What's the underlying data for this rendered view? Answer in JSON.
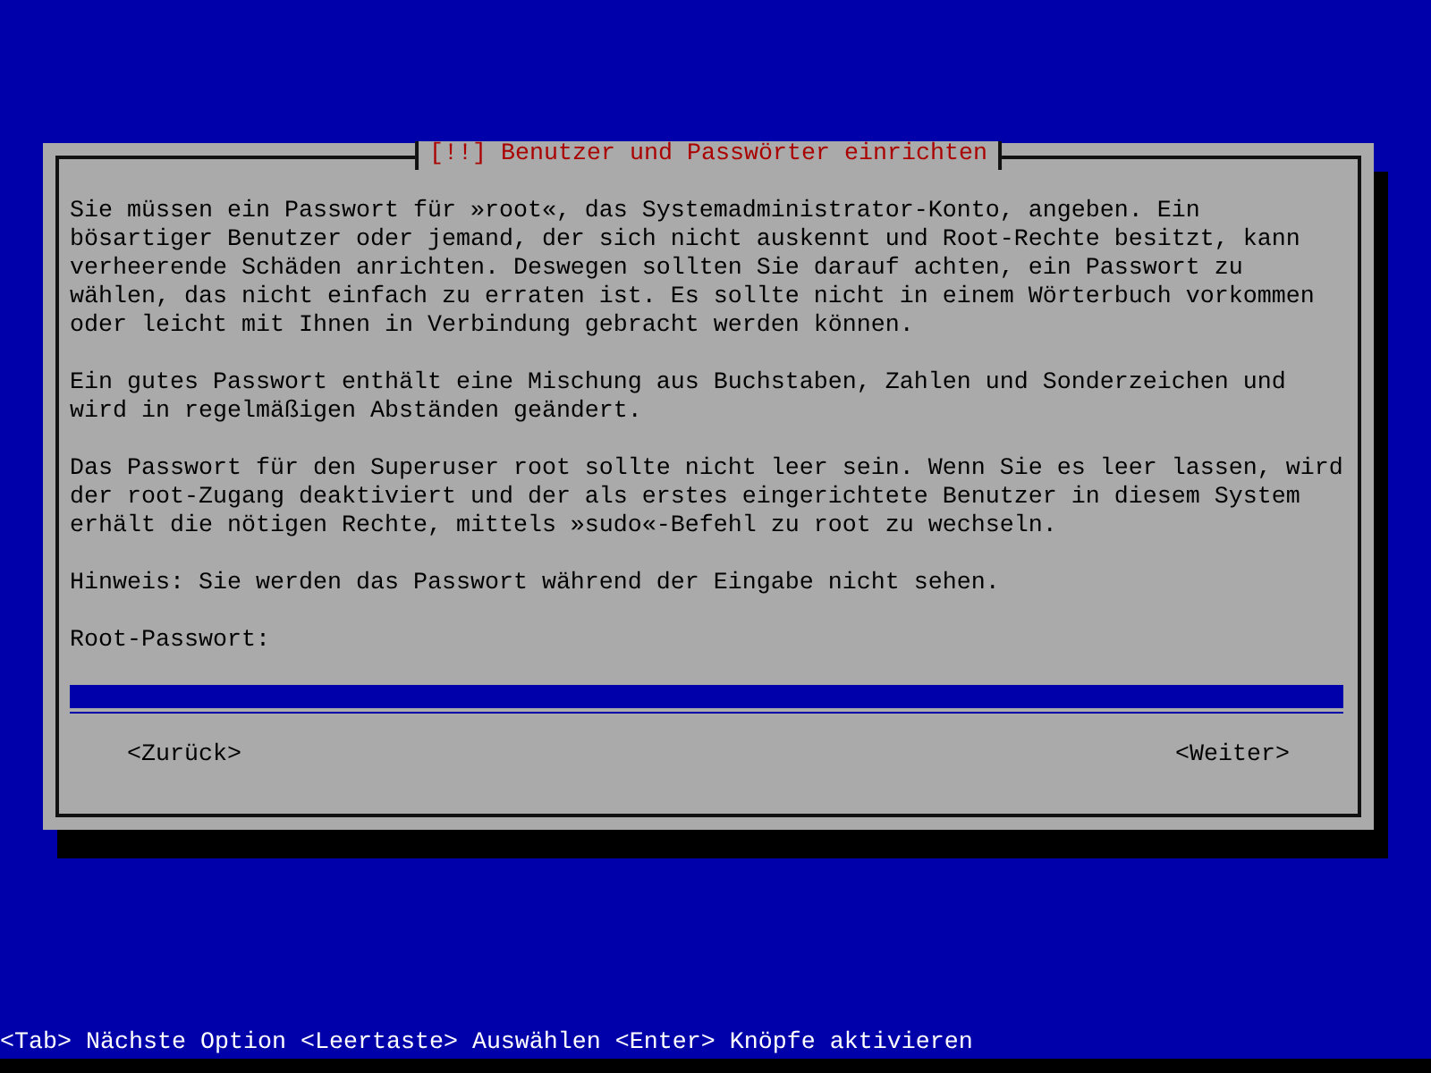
{
  "dialog": {
    "title": "[!!] Benutzer und Passwörter einrichten",
    "paragraphs": [
      "Sie müssen ein Passwort für »root«, das Systemadministrator-Konto, angeben. Ein bösartiger Benutzer oder jemand, der sich nicht auskennt und Root-Rechte besitzt, kann verheerende Schäden anrichten. Deswegen sollten Sie darauf achten, ein Passwort zu wählen, das nicht einfach zu erraten ist. Es sollte nicht in einem Wörterbuch vorkommen oder leicht mit Ihnen in Verbindung gebracht werden können.",
      "Ein gutes Passwort enthält eine Mischung aus Buchstaben, Zahlen und Sonderzeichen und wird in regelmäßigen Abständen geändert.",
      "Das Passwort für den Superuser root sollte nicht leer sein. Wenn Sie es leer lassen, wird der root-Zugang deaktiviert und der als erstes eingerichtete Benutzer in diesem System erhält die nötigen Rechte, mittels »sudo«-Befehl zu root zu wechseln.",
      "Hinweis: Sie werden das Passwort während der Eingabe nicht sehen."
    ],
    "field": {
      "label": "Root-Passwort:"
    },
    "buttons": [
      "<Zurück>",
      "<Weiter>"
    ]
  },
  "status_bar": "<Tab> Nächste Option <Leertaste> Auswählen <Enter> Knöpfe aktivieren"
}
